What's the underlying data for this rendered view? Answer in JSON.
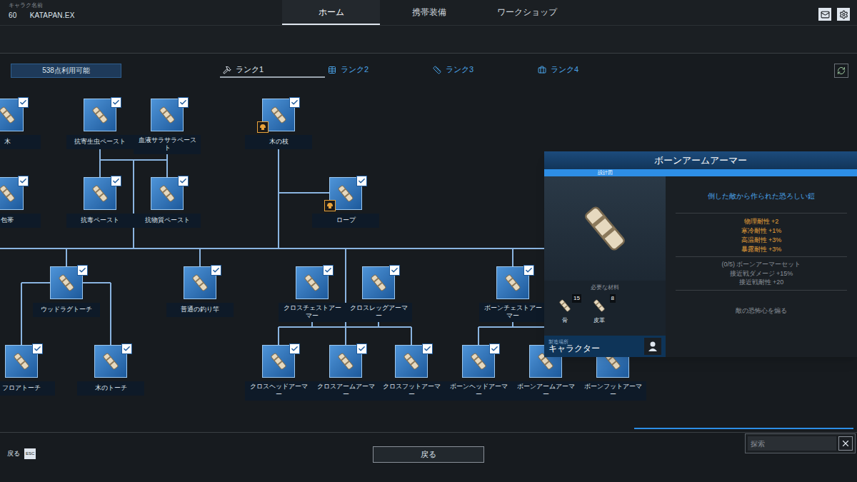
{
  "header": {
    "character_label": "キャラク名前",
    "level": "60",
    "character_name": "KATAPAN.EX"
  },
  "tabs": [
    {
      "label": "ホーム",
      "selected": true
    },
    {
      "label": "携帯装備",
      "selected": false
    },
    {
      "label": "ワークショップ",
      "selected": false
    }
  ],
  "points": "538点利用可能",
  "ranks": [
    {
      "label": "ランク1",
      "selected": true
    },
    {
      "label": "ランク2",
      "selected": false
    },
    {
      "label": "ランク3",
      "selected": false
    },
    {
      "label": "ランク4",
      "selected": false
    }
  ],
  "nodes": [
    {
      "label": "木",
      "unlocked": true,
      "marked": false
    },
    {
      "label": "包帯",
      "unlocked": true,
      "marked": false
    },
    {
      "label": "抗寄生虫ペースト",
      "unlocked": true,
      "marked": false
    },
    {
      "label": "血液サラサラペースト",
      "unlocked": true,
      "marked": false
    },
    {
      "label": "木の枝",
      "unlocked": true,
      "marked": true
    },
    {
      "label": "抗毒ペースト",
      "unlocked": true,
      "marked": false
    },
    {
      "label": "抗物質ペースト",
      "unlocked": true,
      "marked": false
    },
    {
      "label": "ロープ",
      "unlocked": true,
      "marked": true
    },
    {
      "label": "ウッドラグトーチ",
      "unlocked": true,
      "marked": false
    },
    {
      "label": "普通の釣り竿",
      "unlocked": true,
      "marked": false
    },
    {
      "label": "クロスチェストアーマー",
      "unlocked": true,
      "marked": false
    },
    {
      "label": "クロスレッグアーマー",
      "unlocked": true,
      "marked": false
    },
    {
      "label": "ボーンチェストアーマー",
      "unlocked": true,
      "marked": false
    },
    {
      "label": "フロアトーチ",
      "unlocked": true,
      "marked": false
    },
    {
      "label": "木のトーチ",
      "unlocked": true,
      "marked": false
    },
    {
      "label": "クロスヘッドアーマー",
      "unlocked": true,
      "marked": false
    },
    {
      "label": "クロスアームアーマー",
      "unlocked": true,
      "marked": false
    },
    {
      "label": "クロスフットアーマー",
      "unlocked": true,
      "marked": false
    },
    {
      "label": "ボーンヘッドアーマー",
      "unlocked": true,
      "marked": false
    },
    {
      "label": "ボーンアームアーマー",
      "unlocked": true,
      "marked": false
    },
    {
      "label": "ボーンフットアーマー",
      "unlocked": true,
      "marked": false
    }
  ],
  "detail": {
    "title": "ボーンアームアーマー",
    "type": "設計図",
    "description": "倒した敵から作られた恐ろしい鎧",
    "stats": [
      "物理耐性 +2",
      "寒冷耐性 +1%",
      "高温耐性 +3%",
      "暴露耐性 +3%"
    ],
    "set": [
      "(0/5) ボーンアーマーセット",
      "接近戦ダメージ +15%",
      "接近戦耐性 +20"
    ],
    "effect": "敵の恐怖心を煽る",
    "materials_label": "必要な材料",
    "materials": [
      {
        "name": "骨",
        "count": "15"
      },
      {
        "name": "皮革",
        "count": "8"
      }
    ],
    "craft_label": "製造場所",
    "crafter": "キャラクター"
  },
  "footer": {
    "back_label": "戻る",
    "back_key": "ESC",
    "back_button": "戻る",
    "search_placeholder": "探索"
  }
}
